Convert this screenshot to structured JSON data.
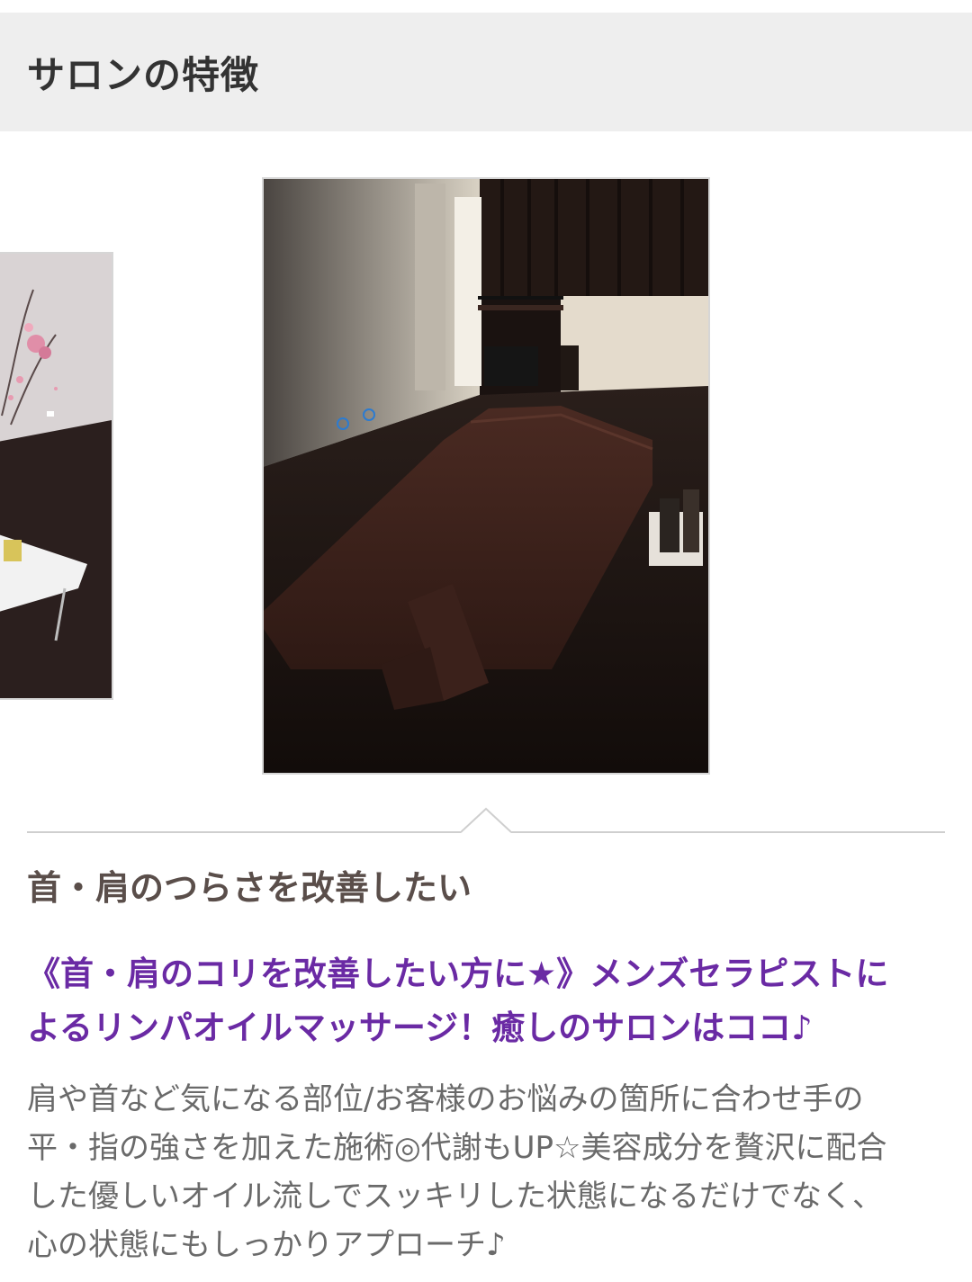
{
  "section": {
    "title": "サロンの特徴"
  },
  "feature": {
    "title": "首・肩のつらさを改善したい",
    "catch_line_1": "《首・肩のコリを改善したい方に★》メンズセラピストに",
    "catch_line_2": "よるリンパオイルマッサージ！癒しのサロンはココ♪",
    "body_line_1": "肩や首など気になる部位/お客様のお悩みの箇所に合わせ手の",
    "body_line_2": "平・指の強さを加えた施術◎代謝もUP☆美容成分を贅沢に配合",
    "body_line_3": "した優しいオイル流しでスッキリした状態になるだけでなく、",
    "body_line_4": "心の状態にもしっかりアプローチ♪"
  },
  "colors": {
    "header_bg": "#eeeeee",
    "catch_purple": "#6a2aa4",
    "title_brown": "#5a4e4a",
    "body_gray": "#6a6a6a"
  }
}
